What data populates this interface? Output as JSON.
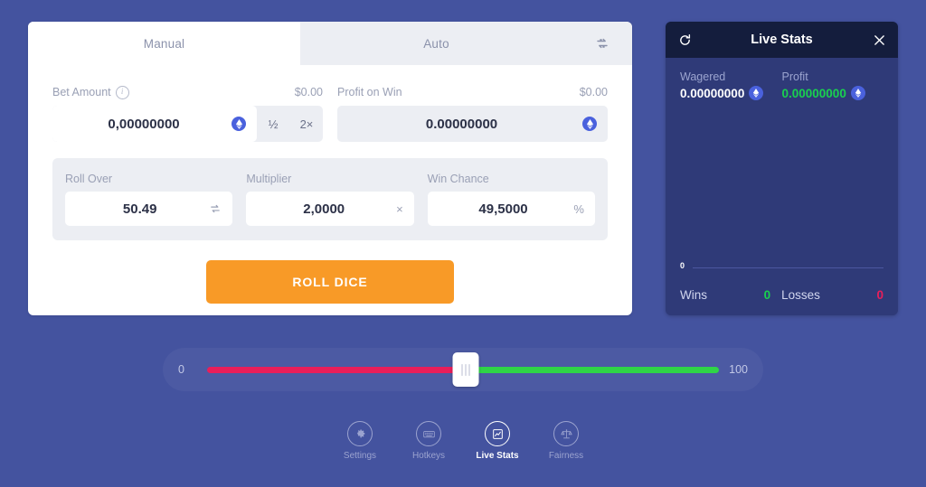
{
  "bet_card": {
    "tabs": [
      {
        "label": "Manual",
        "active": true
      },
      {
        "label": "Auto",
        "active": false
      }
    ],
    "swap_icon": "swap-arrows-icon",
    "bet_amount": {
      "label": "Bet Amount",
      "info_icon": "info-icon",
      "fiat_value": "$0.00",
      "value": "0,00000000",
      "currency_icon": "ethereum-icon",
      "half_label": "½",
      "double_label": "2×"
    },
    "profit_on_win": {
      "label": "Profit on Win",
      "fiat_value": "$0.00",
      "value": "0.00000000",
      "currency_icon": "ethereum-icon"
    },
    "roll_over": {
      "label": "Roll Over",
      "value": "50.49",
      "adorn_icon": "swap-vertical-icon"
    },
    "multiplier": {
      "label": "Multiplier",
      "value": "2,0000",
      "unit": "×"
    },
    "win_chance": {
      "label": "Win Chance",
      "value": "49,5000",
      "unit": "%"
    },
    "roll_button": "ROLL DICE"
  },
  "live_stats": {
    "title": "Live Stats",
    "refresh_icon": "refresh-icon",
    "close_icon": "close-icon",
    "wagered": {
      "label": "Wagered",
      "value": "0.00000000",
      "currency_icon": "ethereum-icon"
    },
    "profit": {
      "label": "Profit",
      "value": "0.00000000",
      "currency_icon": "ethereum-icon"
    },
    "chart_zero_label": "0",
    "wins": {
      "label": "Wins",
      "value": "0"
    },
    "losses": {
      "label": "Losses",
      "value": "0"
    }
  },
  "slider": {
    "min_label": "0",
    "max_label": "100",
    "value": 50.49,
    "low_color": "#e91e5a",
    "high_color": "#2fd447"
  },
  "toolbar": [
    {
      "label": "Settings",
      "icon": "gear-icon",
      "active": false
    },
    {
      "label": "Hotkeys",
      "icon": "keyboard-icon",
      "active": false
    },
    {
      "label": "Live Stats",
      "icon": "chart-icon",
      "active": true
    },
    {
      "label": "Fairness",
      "icon": "scales-icon",
      "active": false
    }
  ],
  "colors": {
    "page_background": "#44539f",
    "accent_orange": "#f89a27",
    "win_green": "#2fd447",
    "loss_red": "#e91e5a",
    "panel_dark": "#2f3a78",
    "panel_header": "#141d3d"
  }
}
